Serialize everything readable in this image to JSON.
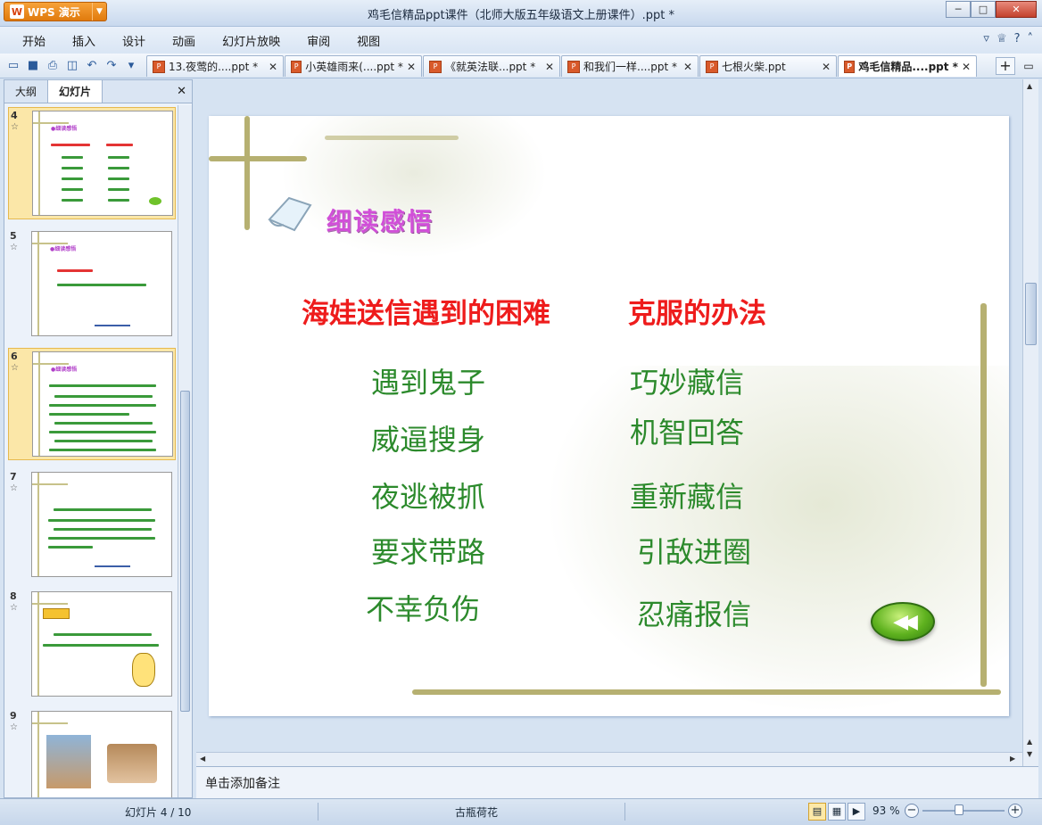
{
  "app": {
    "button_label": "WPS 演示",
    "window_title": "鸡毛信精品ppt课件（北师大版五年级语文上册课件）.ppt *"
  },
  "menu": {
    "items": [
      "开始",
      "插入",
      "设计",
      "动画",
      "幻灯片放映",
      "审阅",
      "视图"
    ]
  },
  "doc_tabs": [
    {
      "label": "13.夜莺的....ppt *",
      "active": false
    },
    {
      "label": "小英雄雨来(....ppt *",
      "active": false
    },
    {
      "label": "《就英法联...ppt *",
      "active": false
    },
    {
      "label": "和我们一样....ppt *",
      "active": false
    },
    {
      "label": "七根火柴.ppt",
      "active": false
    },
    {
      "label": "鸡毛信精品....ppt *",
      "active": true
    }
  ],
  "side_panel": {
    "tabs": [
      "大纲",
      "幻灯片"
    ],
    "active_tab": "幻灯片",
    "slides": [
      {
        "number": "4",
        "selected": true
      },
      {
        "number": "5",
        "selected": false
      },
      {
        "number": "6",
        "selected": true
      },
      {
        "number": "7",
        "selected": false
      },
      {
        "number": "8",
        "selected": false
      },
      {
        "number": "9",
        "selected": false
      }
    ]
  },
  "slide": {
    "title": "细读感悟",
    "heading_left": "海娃送信遇到的困难",
    "heading_right": "克服的办法",
    "difficulties": [
      "遇到鬼子",
      "威逼搜身",
      "夜逃被抓",
      "要求带路",
      "不幸负伤"
    ],
    "solutions": [
      "巧妙藏信",
      "机智回答",
      "重新藏信",
      "引敌进圈",
      "忍痛报信"
    ],
    "colors": {
      "heading": "#ee1c1c",
      "items": "#2c8a2c",
      "title": "#d14fd8"
    }
  },
  "notes": {
    "placeholder": "单击添加备注"
  },
  "status": {
    "slide_info": "幻灯片 4 / 10",
    "theme": "古瓶荷花",
    "zoom": "93 %"
  }
}
